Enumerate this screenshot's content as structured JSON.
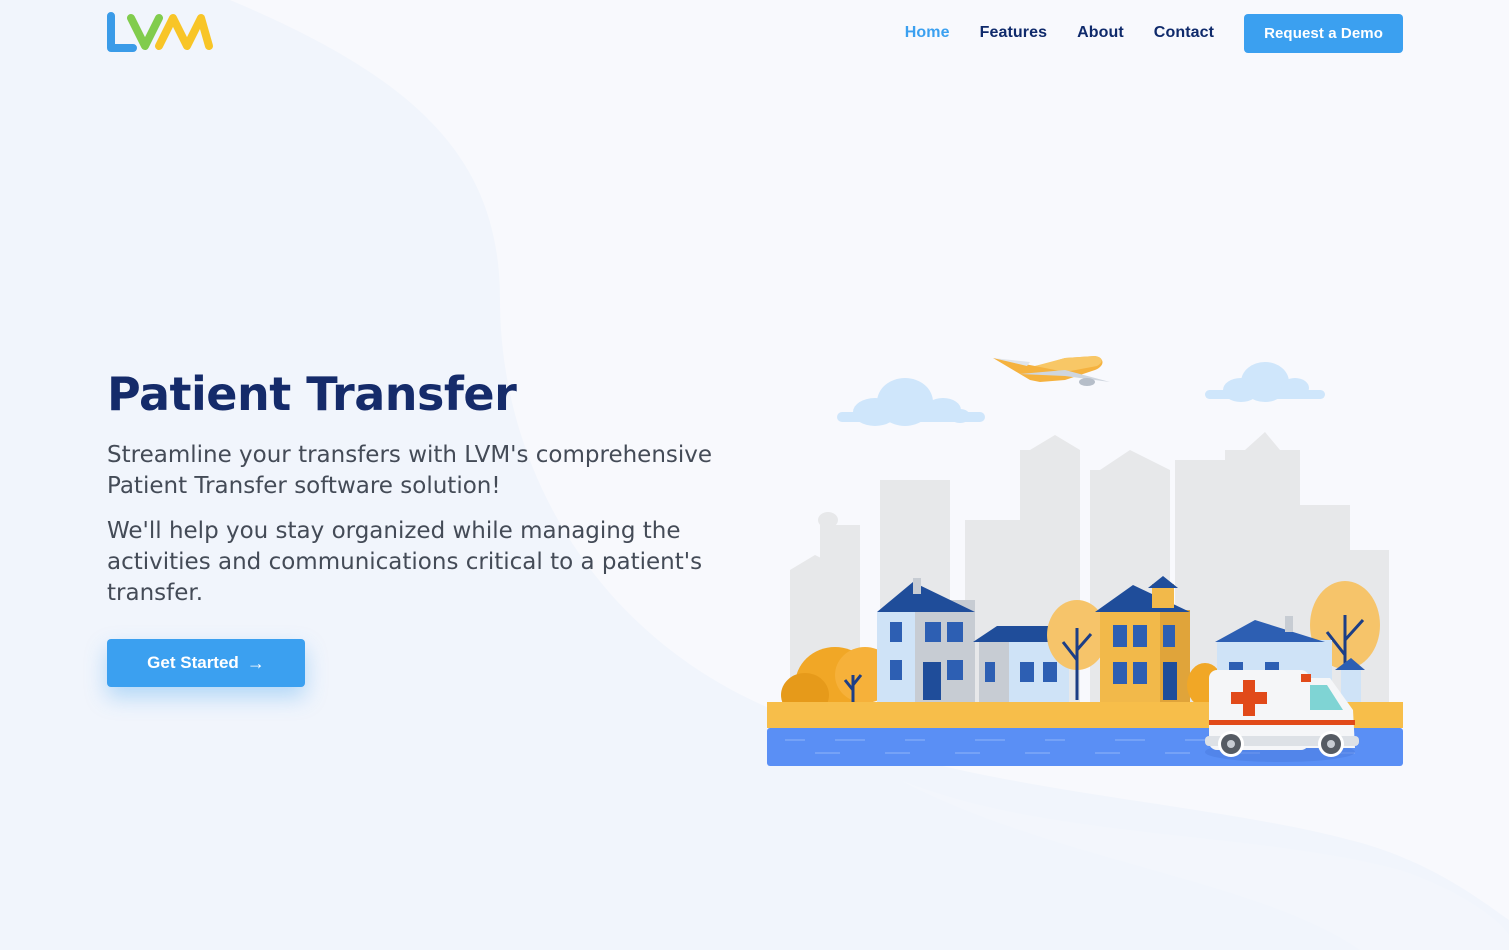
{
  "brand": {
    "logo_text": "LVM"
  },
  "nav": {
    "items": [
      {
        "label": "Home",
        "active": true
      },
      {
        "label": "Features",
        "active": false
      },
      {
        "label": "About",
        "active": false
      },
      {
        "label": "Contact",
        "active": false
      }
    ],
    "demo_label": "Request a Demo"
  },
  "hero": {
    "title": "Patient Transfer",
    "paragraph1": "Streamline your transfers with LVM's comprehensive Patient Transfer software solution!",
    "paragraph2": "We'll help you stay organized while managing the activities and communications critical to a patient's transfer.",
    "cta_label": "Get Started",
    "cta_icon": "arrow-right-icon"
  },
  "colors": {
    "accent": "#3ba0f0",
    "navy": "#152b6a",
    "background": "#f1f5fc"
  }
}
